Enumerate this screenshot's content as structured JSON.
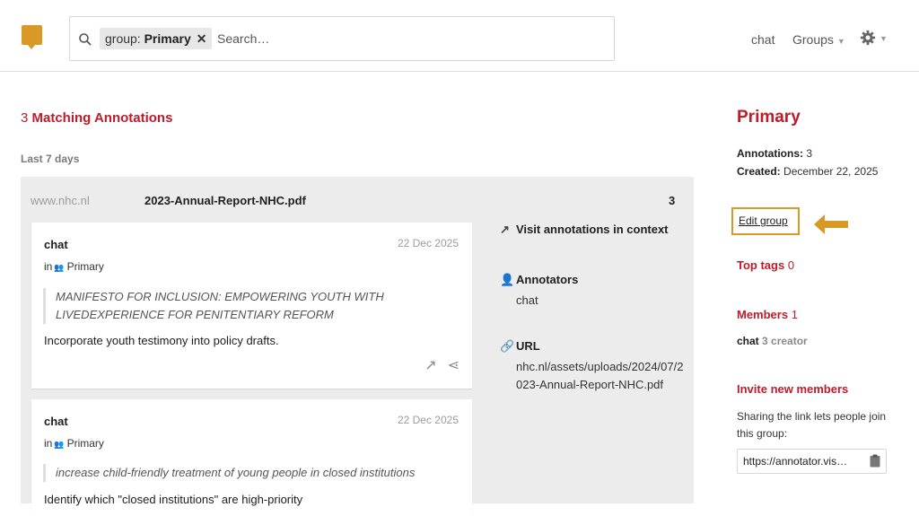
{
  "brand": {
    "color": "#d89a25",
    "logo_icon": "speech-bubble-logo"
  },
  "search": {
    "facet_label": "group: ",
    "facet_value": "Primary",
    "placeholder": "Search…"
  },
  "nav": {
    "user": "chat",
    "groups_label": "Groups",
    "settings_icon": "gear-icon"
  },
  "results": {
    "count": "3",
    "label": " Matching Annotations",
    "period": "Last 7 days"
  },
  "document": {
    "domain": "www.nhc.nl",
    "title": "2023-Annual-Report-NHC.pdf",
    "count": "3",
    "annotations": [
      {
        "user": "chat",
        "date": "22 Dec 2025",
        "group": "Primary",
        "quote": "MANIFESTO FOR INCLUSION: EMPOWERING YOUTH WITH LIVEDEXPERIENCE FOR PENITENTIARY REFORM",
        "text": "Incorporate youth testimony into policy drafts."
      },
      {
        "user": "chat",
        "date": "22 Dec 2025",
        "group": "Primary",
        "quote": "increase child-friendly treatment of young people in closed institutions",
        "text": "Identify which \"closed institutions\" are high-priority"
      }
    ],
    "context": {
      "visit_label": "Visit annotations in context",
      "annotators_label": "Annotators",
      "annotators_value": "chat",
      "url_label": "URL",
      "url_value": "nhc.nl/assets/uploads/2024/07/2023-Annual-Report-NHC.pdf"
    }
  },
  "sidebar": {
    "group_name": "Primary",
    "annotations_label": "Annotations:",
    "annotations_value": " 3",
    "created_label": "Created:",
    "created_value": " December 22, 2025",
    "edit_group": "Edit group",
    "top_tags_label": "Top tags",
    "top_tags_count": "0",
    "members_label": "Members",
    "members_count": "1",
    "member_name": "chat",
    "member_meta": "3 creator",
    "invite_label": "Invite new members",
    "share_text": "Sharing the link lets people join this group:",
    "share_link": "https://annotator.vis…",
    "accent": "#bd1c2b",
    "highlight": "#d89a25"
  }
}
